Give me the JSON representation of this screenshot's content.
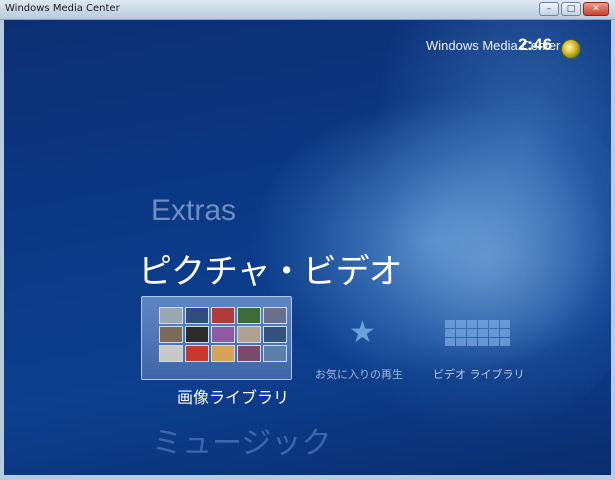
{
  "window": {
    "title": "Windows Media Center",
    "controls": [
      "–",
      "□",
      "✕"
    ]
  },
  "header": {
    "brand": "Windows Media Center",
    "clock": "2:46",
    "logo_icon": "windows-logo-icon"
  },
  "menu": {
    "prev_category": "Extras",
    "current_category": "ピクチャ・ビデオ",
    "next_category": "ミュージック"
  },
  "tiles": [
    {
      "label": "画像ライブラリ",
      "selected": true,
      "icon": "photo-thumbnails-icon"
    },
    {
      "label": "お気に入りの再生",
      "selected": false,
      "icon": "star-icon"
    },
    {
      "label": "ビデオ ライブラリ",
      "selected": false,
      "icon": "video-grid-icon"
    }
  ],
  "thumbnail_colors": [
    "#9aa6b0",
    "#2f4f7a",
    "#b23a3a",
    "#3e6b3a",
    "#6a6f8a",
    "#7d6b5a",
    "#2c2c2c",
    "#8f5aa3",
    "#b0a090",
    "#35507a",
    "#c8c8c8",
    "#c43a2c",
    "#d7a25a",
    "#7a4a6a",
    "#5a7fa8"
  ],
  "colors": {
    "stage_bg": "#0b3a88",
    "accent_text": "#ffffff",
    "dim_text": "#6f8fc0"
  }
}
